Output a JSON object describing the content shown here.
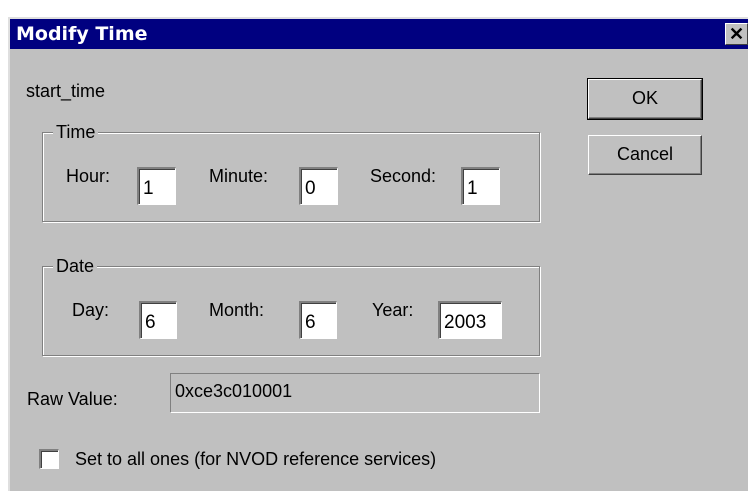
{
  "window": {
    "title": "Modify Time",
    "close_glyph": "✕"
  },
  "field_name": "start_time",
  "time_group": {
    "legend": "Time",
    "hour_label": "Hour:",
    "hour_value": "1",
    "minute_label": "Minute:",
    "minute_value": "0",
    "second_label": "Second:",
    "second_value": "1"
  },
  "date_group": {
    "legend": "Date",
    "day_label": "Day:",
    "day_value": "6",
    "month_label": "Month:",
    "month_value": "6",
    "year_label": "Year:",
    "year_value": "2003"
  },
  "raw": {
    "label": "Raw Value:",
    "value": "0xce3c010001"
  },
  "all_ones": {
    "label": "Set to all ones (for NVOD reference services)",
    "checked": false
  },
  "buttons": {
    "ok": "OK",
    "cancel": "Cancel"
  },
  "colors": {
    "titlebar": "#000080",
    "face": "#c0c0c0"
  }
}
